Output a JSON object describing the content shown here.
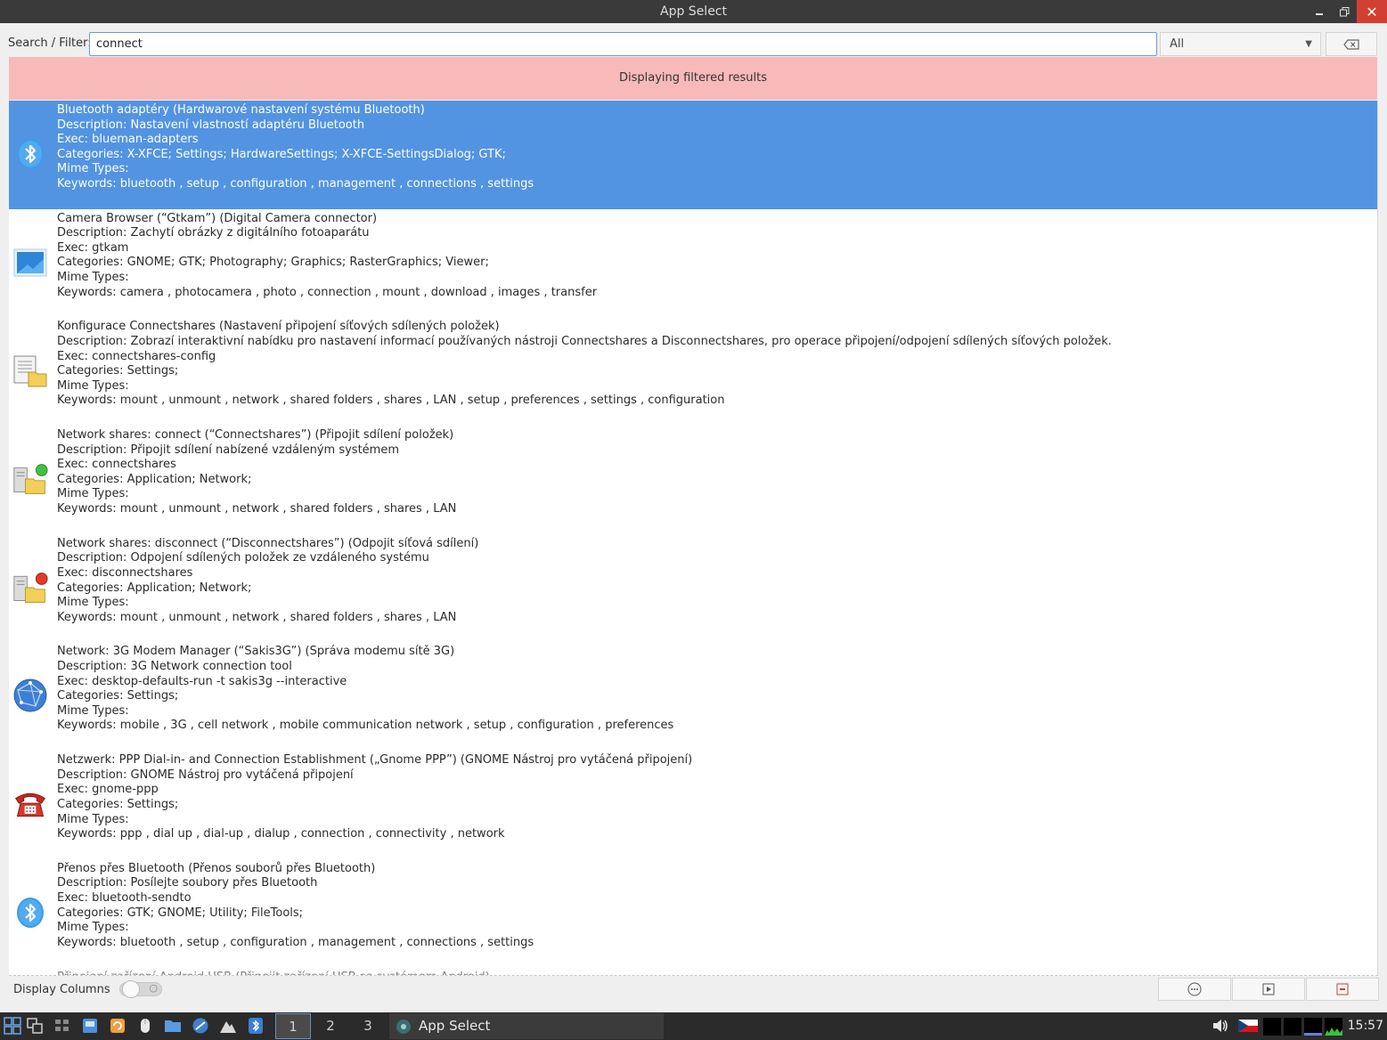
{
  "window": {
    "title": "App Select"
  },
  "search": {
    "label": "Search / Filter:",
    "value": "connect",
    "category": "All"
  },
  "banner": {
    "text": "Displaying filtered results"
  },
  "results": [
    {
      "icon": "bluetooth-icon",
      "selected": true,
      "title": "Bluetooth adaptéry (Hardwarové nastavení systému Bluetooth)",
      "description": "Description: Nastavení vlastností adaptéru Bluetooth",
      "exec": "Exec: blueman-adapters",
      "categories": "Categories: X-XFCE; Settings; HardwareSettings; X-XFCE-SettingsDialog; GTK;",
      "mime": "Mime Types:",
      "keywords": "Keywords: bluetooth , setup , configuration , management , connections , settings"
    },
    {
      "icon": "camera-browser-icon",
      "selected": false,
      "title": "Camera Browser (“Gtkam”) (Digital Camera connector)",
      "description": "Description: Zachytí obrázky z digitálního fotoaparátu",
      "exec": "Exec: gtkam",
      "categories": "Categories: GNOME; GTK; Photography; Graphics; RasterGraphics; Viewer;",
      "mime": "Mime Types:",
      "keywords": "Keywords: camera , photocamera , photo , connection , mount , download , images , transfer"
    },
    {
      "icon": "document-folder-icon",
      "selected": false,
      "title": "Konfigurace Connectshares (Nastavení připojení síťových sdílených položek)",
      "description": "Description: Zobrazí interaktivní nabídku pro nastavení informací používaných nástroji Connectshares a Disconnectshares, pro operace připojení/odpojení sdílených síťových položek.",
      "exec": "Exec: connectshares-config",
      "categories": "Categories: Settings;",
      "mime": "Mime Types:",
      "keywords": "Keywords: mount , unmount , network , shared folders , shares , LAN , setup , preferences , settings , configuration"
    },
    {
      "icon": "network-share-connect-icon",
      "selected": false,
      "title": "Network shares: connect (“Connectshares”) (Připojit sdílení položek)",
      "description": "Description: Připojit sdílení nabízené vzdáleným systémem",
      "exec": "Exec: connectshares",
      "categories": "Categories: Application; Network;",
      "mime": "Mime Types:",
      "keywords": "Keywords: mount , unmount , network , shared folders , shares , LAN"
    },
    {
      "icon": "network-share-disconnect-icon",
      "selected": false,
      "title": "Network shares: disconnect (“Disconnectshares”) (Odpojit síťová sdílení)",
      "description": "Description: Odpojení sdílených položek ze vzdáleného systému",
      "exec": "Exec: disconnectshares",
      "categories": "Categories: Application; Network;",
      "mime": "Mime Types:",
      "keywords": "Keywords: mount , unmount , network , shared folders , shares , LAN"
    },
    {
      "icon": "globe-network-icon",
      "selected": false,
      "title": "Network: 3G Modem Manager (“Sakis3G”) (Správa modemu sítě 3G)",
      "description": "Description: 3G Network connection tool",
      "exec": "Exec: desktop-defaults-run -t sakis3g --interactive",
      "categories": "Categories: Settings;",
      "mime": "Mime Types:",
      "keywords": "Keywords: mobile , 3G , cell network , mobile communication network , setup , configuration , preferences"
    },
    {
      "icon": "telephone-icon",
      "selected": false,
      "title": "Netzwerk: PPP Dial-in- and Connection Establishment („Gnome PPP”) (GNOME Nástroj pro vytáčená připojení)",
      "description": "Description: GNOME Nástroj pro vytáčená připojení",
      "exec": "Exec: gnome-ppp",
      "categories": "Categories: Settings;",
      "mime": "Mime Types:",
      "keywords": "Keywords: ppp , dial up , dial-up , dialup , connection , connectivity , network"
    },
    {
      "icon": "bluetooth-icon",
      "selected": false,
      "title": "Přenos přes Bluetooth (Přenos souborů přes Bluetooth)",
      "description": "Description: Posílejte soubory přes Bluetooth",
      "exec": "Exec: bluetooth-sendto",
      "categories": "Categories: GTK; GNOME; Utility; FileTools;",
      "mime": "Mime Types:",
      "keywords": "Keywords: bluetooth , setup , configuration , management , connections , settings"
    }
  ],
  "partial_result": {
    "title": "Připojení zařízení Android USB (Připojit zařízení USB se systémem Android)"
  },
  "footer": {
    "display_columns_label": "Display Columns"
  },
  "taskbar": {
    "workspaces": [
      "1",
      "2",
      "3"
    ],
    "active_workspace": "1",
    "task_label": "App Select",
    "clock": "15:57"
  },
  "colors": {
    "selection": "#5294e2",
    "banner": "#f8b9b9",
    "titlebar": "#3a3a3a",
    "taskbar": "#2b2b2b"
  }
}
